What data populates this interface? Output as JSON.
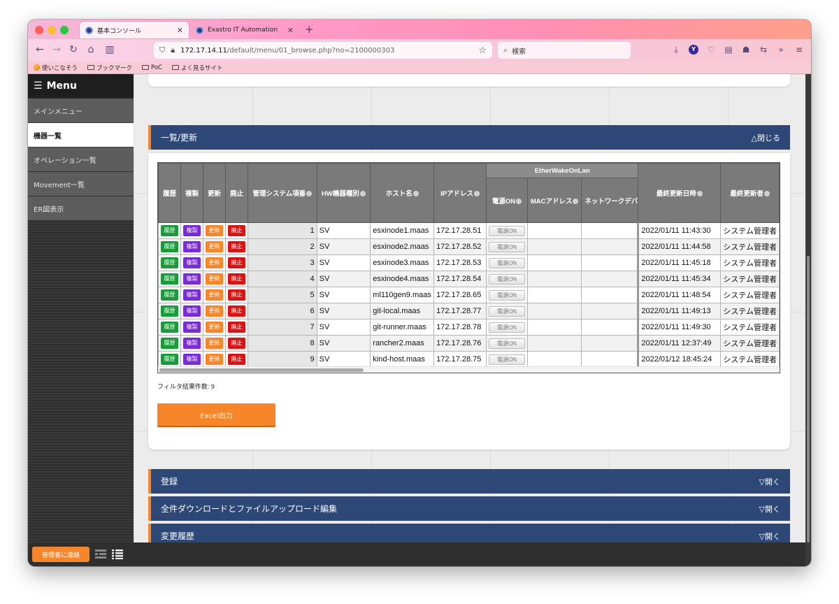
{
  "browser": {
    "tabs": [
      {
        "label": "基本コンソール",
        "active": true
      },
      {
        "label": "Exastro IT Automation",
        "active": false
      }
    ],
    "url_host": "172.17.14.11",
    "url_path": "/default/menu/01_browse.php?no=2100000303",
    "search_placeholder": "検索",
    "bookmarks": [
      "使いこなそう",
      "ブックマーク",
      "PoC",
      "よく見るサイト"
    ]
  },
  "sidebar": {
    "header": "Menu",
    "items": [
      {
        "label": "メインメニュー",
        "active": false
      },
      {
        "label": "機器一覧",
        "active": true
      },
      {
        "label": "オペレーション一覧",
        "active": false
      },
      {
        "label": "Movement一覧",
        "active": false
      },
      {
        "label": "ER図表示",
        "active": false
      }
    ],
    "contact_label": "管理者に連絡"
  },
  "list_section": {
    "title": "一覧/更新",
    "toggle": "△閉じる",
    "group_header": "EtherWakeOnLan",
    "columns": {
      "history": "履歴",
      "duplicate": "複製",
      "update": "更新",
      "discard": "廃止",
      "item_no": "管理システム項番",
      "hw_type": "HW機器種別",
      "host": "ホスト名",
      "ip": "IPアドレス",
      "power": "電源ON",
      "mac": "MACアドレス",
      "netdev": "ネットワークデバ",
      "updated_at": "最終更新日時",
      "updated_by": "最終更新者"
    },
    "buttons": {
      "history": "履歴",
      "duplicate": "複製",
      "update": "更新",
      "discard": "廃止",
      "power": "電源ON"
    },
    "rows": [
      {
        "no": "1",
        "type": "SV",
        "host": "esxinode1.maas",
        "ip": "172.17.28.51",
        "mac": "",
        "netdev": "",
        "updated_at": "2022/01/11 11:43:30",
        "updated_by": "システム管理者"
      },
      {
        "no": "2",
        "type": "SV",
        "host": "esxinode2.maas",
        "ip": "172.17.28.52",
        "mac": "",
        "netdev": "",
        "updated_at": "2022/01/11 11:44:58",
        "updated_by": "システム管理者"
      },
      {
        "no": "3",
        "type": "SV",
        "host": "esxinode3.maas",
        "ip": "172.17.28.53",
        "mac": "",
        "netdev": "",
        "updated_at": "2022/01/11 11:45:18",
        "updated_by": "システム管理者"
      },
      {
        "no": "4",
        "type": "SV",
        "host": "esxinode4.maas",
        "ip": "172.17.28.54",
        "mac": "",
        "netdev": "",
        "updated_at": "2022/01/11 11:45:34",
        "updated_by": "システム管理者"
      },
      {
        "no": "5",
        "type": "SV",
        "host": "ml110gen9.maas",
        "ip": "172.17.28.65",
        "mac": "",
        "netdev": "",
        "updated_at": "2022/01/11 11:48:54",
        "updated_by": "システム管理者"
      },
      {
        "no": "6",
        "type": "SV",
        "host": "git-local.maas",
        "ip": "172.17.28.77",
        "mac": "",
        "netdev": "",
        "updated_at": "2022/01/11 11:49:13",
        "updated_by": "システム管理者"
      },
      {
        "no": "7",
        "type": "SV",
        "host": "git-runner.maas",
        "ip": "172.17.28.78",
        "mac": "",
        "netdev": "",
        "updated_at": "2022/01/11 11:49:30",
        "updated_by": "システム管理者"
      },
      {
        "no": "8",
        "type": "SV",
        "host": "rancher2.maas",
        "ip": "172.17.28.76",
        "mac": "",
        "netdev": "",
        "updated_at": "2022/01/11 12:37:49",
        "updated_by": "システム管理者"
      },
      {
        "no": "9",
        "type": "SV",
        "host": "kind-host.maas",
        "ip": "172.17.28.75",
        "mac": "",
        "netdev": "",
        "updated_at": "2022/01/12 18:45:24",
        "updated_by": "システム管理者"
      }
    ],
    "filter_count": "フィルタ結果件数: 9",
    "excel_label": "Excel出力"
  },
  "collapsed_sections": [
    {
      "title": "登録",
      "toggle": "▽開く"
    },
    {
      "title": "全件ダウンロードとファイルアップロード編集",
      "toggle": "▽開く"
    },
    {
      "title": "変更履歴",
      "toggle": "▽開く"
    }
  ],
  "colors": {
    "accent_orange": "#f7862a",
    "section_blue": "#2d4877",
    "history_green": "#1a9a3a",
    "duplicate_purple": "#7a2bd8",
    "discard_red": "#d81414"
  }
}
